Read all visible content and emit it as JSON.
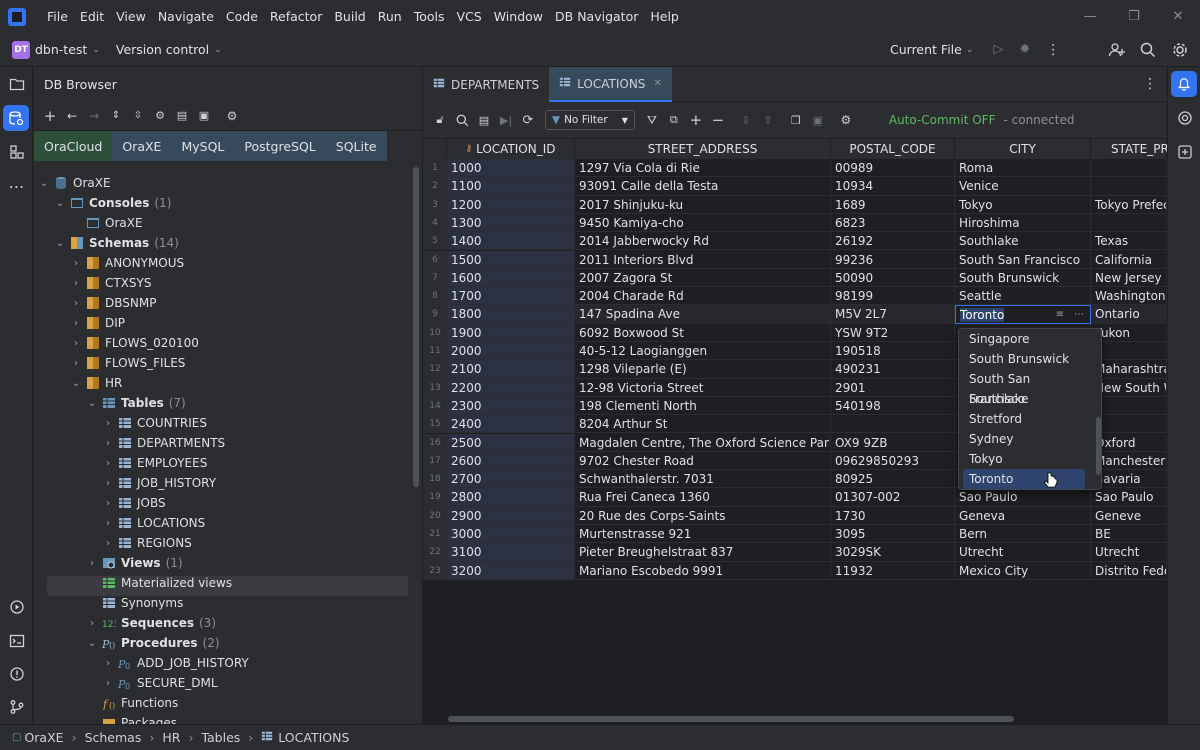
{
  "menubar": {
    "items": [
      {
        "label": "File"
      },
      {
        "label": "Edit"
      },
      {
        "label": "View"
      },
      {
        "label": "Navigate"
      },
      {
        "label": "Code"
      },
      {
        "label": "Refactor"
      },
      {
        "label": "Build"
      },
      {
        "label": "Run"
      },
      {
        "label": "Tools"
      },
      {
        "label": "VCS"
      },
      {
        "label": "Window"
      },
      {
        "label": "DB Navigator"
      },
      {
        "label": "Help"
      }
    ]
  },
  "toolbar": {
    "project_badge": "DT",
    "project_name": "dbn-test",
    "vcs_label": "Version control",
    "run_config": "Current File"
  },
  "db_browser": {
    "title": "DB Browser",
    "connection_tabs": [
      {
        "label": "OraCloud",
        "color": "#2e4f3a"
      },
      {
        "label": "OraXE",
        "color": "#374a5c"
      },
      {
        "label": "MySQL",
        "color": "#374a5c"
      },
      {
        "label": "PostgreSQL",
        "color": "#374a5c"
      },
      {
        "label": "SQLite",
        "color": "#374a5c"
      }
    ],
    "tree": {
      "root": "OraXE",
      "consoles": {
        "label": "Consoles",
        "count": "(1)"
      },
      "console_item": "OraXE",
      "schemas": {
        "label": "Schemas",
        "count": "(14)"
      },
      "schema_list": [
        "ANONYMOUS",
        "CTXSYS",
        "DBSNMP",
        "DIP",
        "FLOWS_020100",
        "FLOWS_FILES",
        "HR"
      ],
      "tables": {
        "label": "Tables",
        "count": "(7)"
      },
      "table_list": [
        "COUNTRIES",
        "DEPARTMENTS",
        "EMPLOYEES",
        "JOB_HISTORY",
        "JOBS",
        "LOCATIONS",
        "REGIONS"
      ],
      "views": {
        "label": "Views",
        "count": "(1)"
      },
      "materialized_views": "Materialized views",
      "synonyms": "Synonyms",
      "sequences": {
        "label": "Sequences",
        "count": "(3)"
      },
      "procedures": {
        "label": "Procedures",
        "count": "(2)"
      },
      "procedure_list": [
        "ADD_JOB_HISTORY",
        "SECURE_DML"
      ],
      "functions": "Functions",
      "packages": "Packages"
    }
  },
  "editor": {
    "tabs": [
      {
        "label": "DEPARTMENTS"
      },
      {
        "label": "LOCATIONS"
      }
    ],
    "filter_label": "No Filter",
    "auto_commit": "Auto-Commit OFF",
    "connection_status": "- connected",
    "columns": [
      "LOCATION_ID",
      "STREET_ADDRESS",
      "POSTAL_CODE",
      "CITY",
      "STATE_PRO"
    ],
    "rows": [
      [
        "1",
        "1000",
        "1297 Via Cola di Rie",
        "00989",
        "Roma",
        ""
      ],
      [
        "2",
        "1100",
        "93091 Calle della Testa",
        "10934",
        "Venice",
        ""
      ],
      [
        "3",
        "1200",
        "2017 Shinjuku-ku",
        "1689",
        "Tokyo",
        "Tokyo Prefect"
      ],
      [
        "4",
        "1300",
        "9450 Kamiya-cho",
        "6823",
        "Hiroshima",
        ""
      ],
      [
        "5",
        "1400",
        "2014 Jabberwocky Rd",
        "26192",
        "Southlake",
        "Texas"
      ],
      [
        "6",
        "1500",
        "2011 Interiors Blvd",
        "99236",
        "South San Francisco",
        "California"
      ],
      [
        "7",
        "1600",
        "2007 Zagora St",
        "50090",
        "South Brunswick",
        "New Jersey"
      ],
      [
        "8",
        "1700",
        "2004 Charade Rd",
        "98199",
        "Seattle",
        "Washington"
      ],
      [
        "9",
        "1800",
        "147 Spadina Ave",
        "M5V 2L7",
        "Toronto",
        "Ontario"
      ],
      [
        "10",
        "1900",
        "6092 Boxwood St",
        "YSW 9T2",
        "",
        "Yukon"
      ],
      [
        "11",
        "2000",
        "40-5-12 Laogianggen",
        "190518",
        "",
        ""
      ],
      [
        "12",
        "2100",
        "1298 Vileparle (E)",
        "490231",
        "",
        "Maharashtra"
      ],
      [
        "13",
        "2200",
        "12-98 Victoria Street",
        "2901",
        "",
        "New South W"
      ],
      [
        "14",
        "2300",
        "198 Clementi North",
        "540198",
        "",
        ""
      ],
      [
        "15",
        "2400",
        "8204 Arthur St",
        "",
        "",
        ""
      ],
      [
        "16",
        "2500",
        "Magdalen Centre, The Oxford Science Park",
        "OX9 9ZB",
        "",
        "Oxford"
      ],
      [
        "17",
        "2600",
        "9702 Chester Road",
        "09629850293",
        "",
        "Manchester"
      ],
      [
        "18",
        "2700",
        "Schwanthalerstr. 7031",
        "80925",
        "",
        "Bavaria"
      ],
      [
        "19",
        "2800",
        "Rua Frei Caneca 1360",
        "01307-002",
        "Sao Paulo",
        "Sao Paulo"
      ],
      [
        "20",
        "2900",
        "20 Rue des Corps-Saints",
        "1730",
        "Geneva",
        "Geneve"
      ],
      [
        "21",
        "3000",
        "Murtenstrasse 921",
        "3095",
        "Bern",
        "BE"
      ],
      [
        "22",
        "3100",
        "Pieter Breughelstraat 837",
        "3029SK",
        "Utrecht",
        "Utrecht"
      ],
      [
        "23",
        "3200",
        "Mariano Escobedo 9991",
        "11932",
        "Mexico City",
        "Distrito Feder"
      ]
    ],
    "city_dropdown": {
      "options": [
        "Singapore",
        "South Brunswick",
        "South San Francisco",
        "Southlake",
        "Stretford",
        "Sydney",
        "Tokyo",
        "Toronto"
      ],
      "selected": "Toronto"
    }
  },
  "statusbar": {
    "breadcrumbs": [
      "OraXE",
      "Schemas",
      "HR",
      "Tables",
      "LOCATIONS"
    ]
  },
  "colors": {
    "accent": "#3574f0",
    "autocommit": "#5fb865",
    "pk_column_bg": "#2b3140",
    "selection": "#2e436e"
  }
}
